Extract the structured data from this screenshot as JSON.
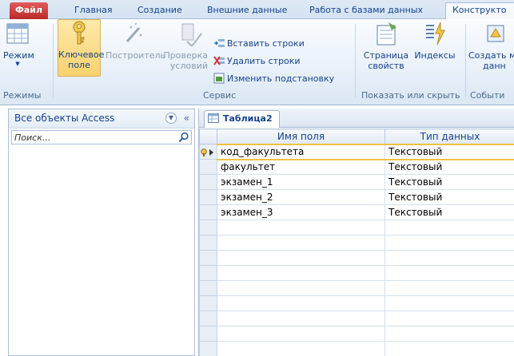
{
  "ribbon": {
    "tabs": {
      "file": "Файл",
      "home": "Главная",
      "create": "Создание",
      "external": "Внешние данные",
      "dbtools": "Работа с базами данных",
      "design": "Конструкто"
    },
    "groups": {
      "views": {
        "label": "Режимы",
        "view_button": "Режим"
      },
      "tools": {
        "label": "Сервис",
        "primary_key_line1": "Ключевое",
        "primary_key_line2": "поле",
        "builder": "Построитель",
        "test_rules_line1": "Проверка",
        "test_rules_line2": "условий",
        "insert_rows": "Вставить строки",
        "delete_rows": "Удалить строки",
        "modify_lookups": "Изменить подстановку"
      },
      "show_hide": {
        "label": "Показать или скрыть",
        "property_sheet_line1": "Страница",
        "property_sheet_line2": "свойств",
        "indexes": "Индексы"
      },
      "events": {
        "label": "Событи",
        "create_macros_line1": "Создать м",
        "create_macros_line2": "данн"
      }
    }
  },
  "nav": {
    "title": "Все объекты Access",
    "search_placeholder": "Поиск..."
  },
  "document": {
    "tab_label": "Таблица2",
    "columns": [
      "Имя поля",
      "Тип данных"
    ],
    "rows": [
      {
        "field": "код_факультета",
        "type": "Текстовый",
        "primary_key": true
      },
      {
        "field": "факультет",
        "type": "Текстовый"
      },
      {
        "field": "экзамен_1",
        "type": "Текстовый"
      },
      {
        "field": "экзамен_2",
        "type": "Текстовый"
      },
      {
        "field": "экзамен_3",
        "type": "Текстовый"
      }
    ]
  },
  "colors": {
    "file_tab": "#c8383a",
    "accent_text": "#15428b",
    "current_row_border": "#f0c040"
  }
}
